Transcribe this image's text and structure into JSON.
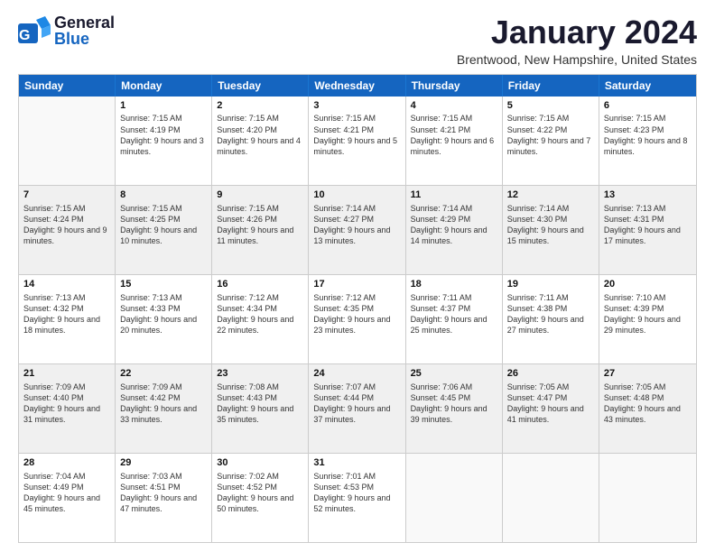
{
  "logo": {
    "text_general": "General",
    "text_blue": "Blue"
  },
  "title": "January 2024",
  "location": "Brentwood, New Hampshire, United States",
  "header_days": [
    "Sunday",
    "Monday",
    "Tuesday",
    "Wednesday",
    "Thursday",
    "Friday",
    "Saturday"
  ],
  "weeks": [
    [
      {
        "day": "",
        "sunrise": "",
        "sunset": "",
        "daylight": "",
        "shaded": false,
        "empty": true
      },
      {
        "day": "1",
        "sunrise": "Sunrise: 7:15 AM",
        "sunset": "Sunset: 4:19 PM",
        "daylight": "Daylight: 9 hours and 3 minutes.",
        "shaded": false
      },
      {
        "day": "2",
        "sunrise": "Sunrise: 7:15 AM",
        "sunset": "Sunset: 4:20 PM",
        "daylight": "Daylight: 9 hours and 4 minutes.",
        "shaded": false
      },
      {
        "day": "3",
        "sunrise": "Sunrise: 7:15 AM",
        "sunset": "Sunset: 4:21 PM",
        "daylight": "Daylight: 9 hours and 5 minutes.",
        "shaded": false
      },
      {
        "day": "4",
        "sunrise": "Sunrise: 7:15 AM",
        "sunset": "Sunset: 4:21 PM",
        "daylight": "Daylight: 9 hours and 6 minutes.",
        "shaded": false
      },
      {
        "day": "5",
        "sunrise": "Sunrise: 7:15 AM",
        "sunset": "Sunset: 4:22 PM",
        "daylight": "Daylight: 9 hours and 7 minutes.",
        "shaded": false
      },
      {
        "day": "6",
        "sunrise": "Sunrise: 7:15 AM",
        "sunset": "Sunset: 4:23 PM",
        "daylight": "Daylight: 9 hours and 8 minutes.",
        "shaded": false
      }
    ],
    [
      {
        "day": "7",
        "sunrise": "Sunrise: 7:15 AM",
        "sunset": "Sunset: 4:24 PM",
        "daylight": "Daylight: 9 hours and 9 minutes.",
        "shaded": true
      },
      {
        "day": "8",
        "sunrise": "Sunrise: 7:15 AM",
        "sunset": "Sunset: 4:25 PM",
        "daylight": "Daylight: 9 hours and 10 minutes.",
        "shaded": true
      },
      {
        "day": "9",
        "sunrise": "Sunrise: 7:15 AM",
        "sunset": "Sunset: 4:26 PM",
        "daylight": "Daylight: 9 hours and 11 minutes.",
        "shaded": true
      },
      {
        "day": "10",
        "sunrise": "Sunrise: 7:14 AM",
        "sunset": "Sunset: 4:27 PM",
        "daylight": "Daylight: 9 hours and 13 minutes.",
        "shaded": true
      },
      {
        "day": "11",
        "sunrise": "Sunrise: 7:14 AM",
        "sunset": "Sunset: 4:29 PM",
        "daylight": "Daylight: 9 hours and 14 minutes.",
        "shaded": true
      },
      {
        "day": "12",
        "sunrise": "Sunrise: 7:14 AM",
        "sunset": "Sunset: 4:30 PM",
        "daylight": "Daylight: 9 hours and 15 minutes.",
        "shaded": true
      },
      {
        "day": "13",
        "sunrise": "Sunrise: 7:13 AM",
        "sunset": "Sunset: 4:31 PM",
        "daylight": "Daylight: 9 hours and 17 minutes.",
        "shaded": true
      }
    ],
    [
      {
        "day": "14",
        "sunrise": "Sunrise: 7:13 AM",
        "sunset": "Sunset: 4:32 PM",
        "daylight": "Daylight: 9 hours and 18 minutes.",
        "shaded": false
      },
      {
        "day": "15",
        "sunrise": "Sunrise: 7:13 AM",
        "sunset": "Sunset: 4:33 PM",
        "daylight": "Daylight: 9 hours and 20 minutes.",
        "shaded": false
      },
      {
        "day": "16",
        "sunrise": "Sunrise: 7:12 AM",
        "sunset": "Sunset: 4:34 PM",
        "daylight": "Daylight: 9 hours and 22 minutes.",
        "shaded": false
      },
      {
        "day": "17",
        "sunrise": "Sunrise: 7:12 AM",
        "sunset": "Sunset: 4:35 PM",
        "daylight": "Daylight: 9 hours and 23 minutes.",
        "shaded": false
      },
      {
        "day": "18",
        "sunrise": "Sunrise: 7:11 AM",
        "sunset": "Sunset: 4:37 PM",
        "daylight": "Daylight: 9 hours and 25 minutes.",
        "shaded": false
      },
      {
        "day": "19",
        "sunrise": "Sunrise: 7:11 AM",
        "sunset": "Sunset: 4:38 PM",
        "daylight": "Daylight: 9 hours and 27 minutes.",
        "shaded": false
      },
      {
        "day": "20",
        "sunrise": "Sunrise: 7:10 AM",
        "sunset": "Sunset: 4:39 PM",
        "daylight": "Daylight: 9 hours and 29 minutes.",
        "shaded": false
      }
    ],
    [
      {
        "day": "21",
        "sunrise": "Sunrise: 7:09 AM",
        "sunset": "Sunset: 4:40 PM",
        "daylight": "Daylight: 9 hours and 31 minutes.",
        "shaded": true
      },
      {
        "day": "22",
        "sunrise": "Sunrise: 7:09 AM",
        "sunset": "Sunset: 4:42 PM",
        "daylight": "Daylight: 9 hours and 33 minutes.",
        "shaded": true
      },
      {
        "day": "23",
        "sunrise": "Sunrise: 7:08 AM",
        "sunset": "Sunset: 4:43 PM",
        "daylight": "Daylight: 9 hours and 35 minutes.",
        "shaded": true
      },
      {
        "day": "24",
        "sunrise": "Sunrise: 7:07 AM",
        "sunset": "Sunset: 4:44 PM",
        "daylight": "Daylight: 9 hours and 37 minutes.",
        "shaded": true
      },
      {
        "day": "25",
        "sunrise": "Sunrise: 7:06 AM",
        "sunset": "Sunset: 4:45 PM",
        "daylight": "Daylight: 9 hours and 39 minutes.",
        "shaded": true
      },
      {
        "day": "26",
        "sunrise": "Sunrise: 7:05 AM",
        "sunset": "Sunset: 4:47 PM",
        "daylight": "Daylight: 9 hours and 41 minutes.",
        "shaded": true
      },
      {
        "day": "27",
        "sunrise": "Sunrise: 7:05 AM",
        "sunset": "Sunset: 4:48 PM",
        "daylight": "Daylight: 9 hours and 43 minutes.",
        "shaded": true
      }
    ],
    [
      {
        "day": "28",
        "sunrise": "Sunrise: 7:04 AM",
        "sunset": "Sunset: 4:49 PM",
        "daylight": "Daylight: 9 hours and 45 minutes.",
        "shaded": false
      },
      {
        "day": "29",
        "sunrise": "Sunrise: 7:03 AM",
        "sunset": "Sunset: 4:51 PM",
        "daylight": "Daylight: 9 hours and 47 minutes.",
        "shaded": false
      },
      {
        "day": "30",
        "sunrise": "Sunrise: 7:02 AM",
        "sunset": "Sunset: 4:52 PM",
        "daylight": "Daylight: 9 hours and 50 minutes.",
        "shaded": false
      },
      {
        "day": "31",
        "sunrise": "Sunrise: 7:01 AM",
        "sunset": "Sunset: 4:53 PM",
        "daylight": "Daylight: 9 hours and 52 minutes.",
        "shaded": false
      },
      {
        "day": "",
        "sunrise": "",
        "sunset": "",
        "daylight": "",
        "shaded": false,
        "empty": true
      },
      {
        "day": "",
        "sunrise": "",
        "sunset": "",
        "daylight": "",
        "shaded": false,
        "empty": true
      },
      {
        "day": "",
        "sunrise": "",
        "sunset": "",
        "daylight": "",
        "shaded": false,
        "empty": true
      }
    ]
  ]
}
